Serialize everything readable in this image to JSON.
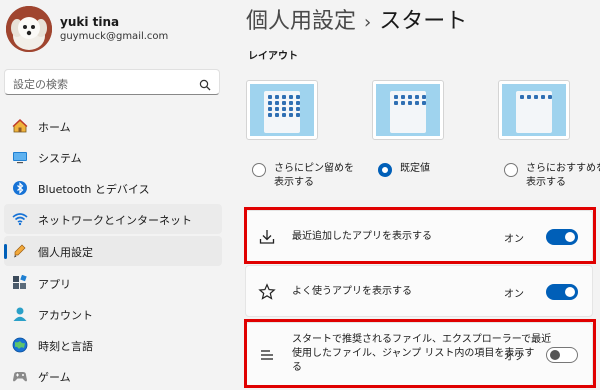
{
  "user": {
    "name": "yuki tina",
    "email": "guymuck@gmail.com"
  },
  "search": {
    "placeholder": "設定の検索"
  },
  "sidebar": {
    "items": [
      {
        "label": "ホーム",
        "icon": "home-icon"
      },
      {
        "label": "システム",
        "icon": "system-icon"
      },
      {
        "label": "Bluetooth とデバイス",
        "icon": "bluetooth-icon"
      },
      {
        "label": "ネットワークとインターネット",
        "icon": "network-icon"
      },
      {
        "label": "個人用設定",
        "icon": "personalization-icon"
      },
      {
        "label": "アプリ",
        "icon": "apps-icon"
      },
      {
        "label": "アカウント",
        "icon": "account-icon"
      },
      {
        "label": "時刻と言語",
        "icon": "time-language-icon"
      },
      {
        "label": "ゲーム",
        "icon": "gaming-icon"
      }
    ],
    "selected_index": 4,
    "accent": "#005fb8"
  },
  "header": {
    "parent": "個人用設定",
    "separator": "›",
    "current": "スタート"
  },
  "layout": {
    "section_label": "レイアウト",
    "options": [
      {
        "line1": "さらにピン留めを",
        "line2": "表示する",
        "checked": false
      },
      {
        "line1": "既定値",
        "line2": "",
        "checked": true
      },
      {
        "line1": "さらにおすすめを",
        "line2": "表示する",
        "checked": false
      }
    ]
  },
  "settings": [
    {
      "label": "最近追加したアプリを表示する",
      "state": "オン",
      "on": true,
      "icon": "download-icon"
    },
    {
      "label": "よく使うアプリを表示する",
      "state": "オン",
      "on": true,
      "icon": "star-icon"
    },
    {
      "label_line1": "スタートで推奨されるファイル、エクスプローラーで最近",
      "label_line2": "使用したファイル、ジャンプ リスト内の項目を表示す",
      "label_line3": "る",
      "state": "オフ",
      "on": false,
      "icon": "list-icon"
    }
  ],
  "colors": {
    "highlight": "#e00000",
    "toggle_on": "#005fb8"
  }
}
